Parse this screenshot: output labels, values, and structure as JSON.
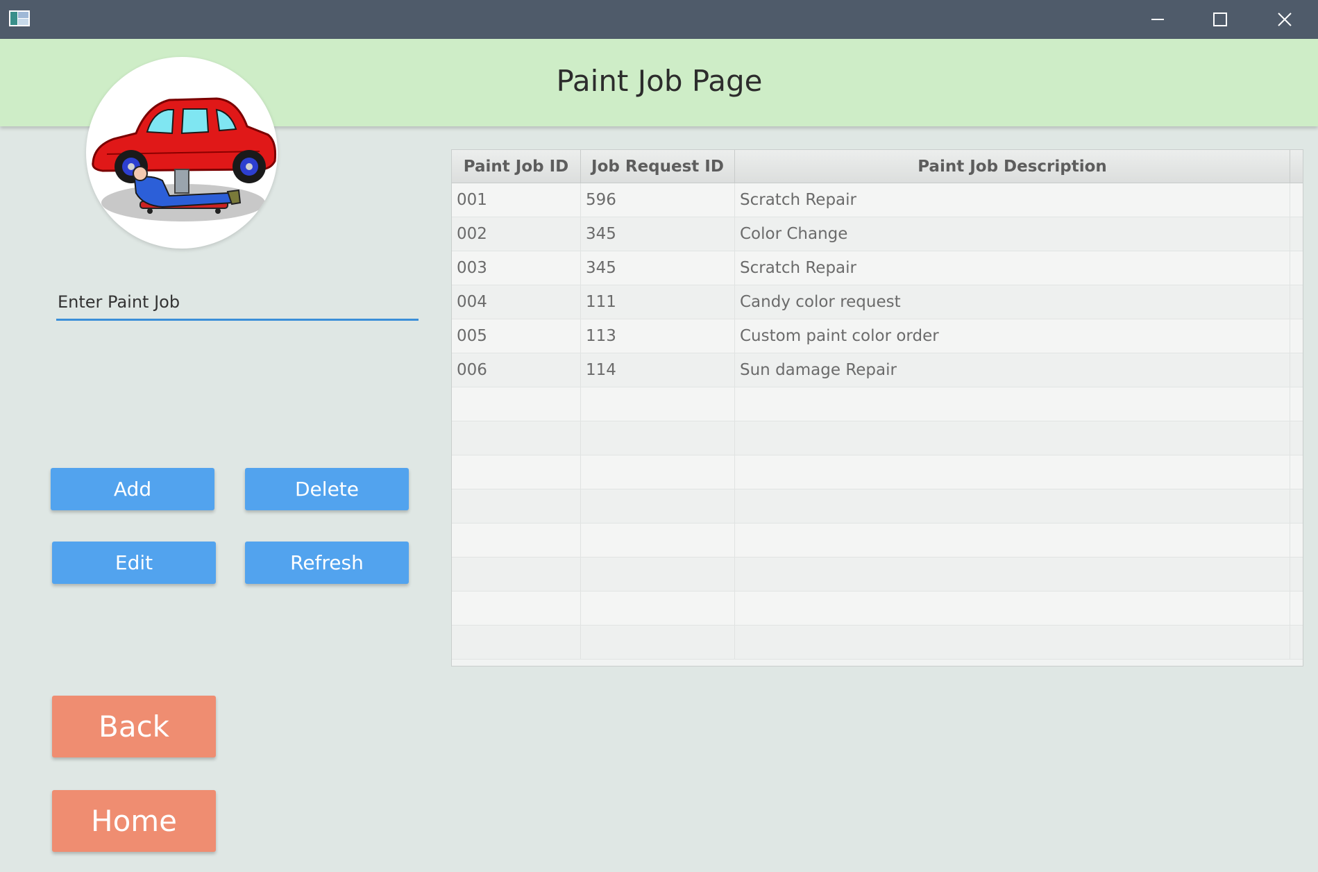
{
  "window": {
    "minimize_icon": "minimize-icon",
    "maximize_icon": "maximize-icon",
    "close_icon": "close-icon"
  },
  "header": {
    "title": "Paint Job Page"
  },
  "logo": {
    "icon": "car-mechanic-icon"
  },
  "search": {
    "placeholder": "Enter Paint Job"
  },
  "buttons": {
    "add": "Add",
    "delete": "Delete",
    "edit": "Edit",
    "refresh": "Refresh",
    "back": "Back",
    "home": "Home"
  },
  "table": {
    "columns": [
      "Paint Job ID",
      "Job Request ID",
      "Paint Job Description"
    ],
    "rows": [
      [
        "001",
        "596",
        "Scratch Repair"
      ],
      [
        "002",
        "345",
        "Color Change"
      ],
      [
        "003",
        "345",
        "Scratch Repair"
      ],
      [
        "004",
        "111",
        "Candy color request"
      ],
      [
        "005",
        "113",
        "Custom paint color order"
      ],
      [
        "006",
        "114",
        "Sun damage Repair"
      ]
    ]
  },
  "colors": {
    "titlebar": "#4f5b6a",
    "header": "#ceedc7",
    "background": "#dfe7e4",
    "primary_button": "#52a3ee",
    "nav_button": "#ef8d71",
    "input_underline": "#3b8fd8"
  }
}
